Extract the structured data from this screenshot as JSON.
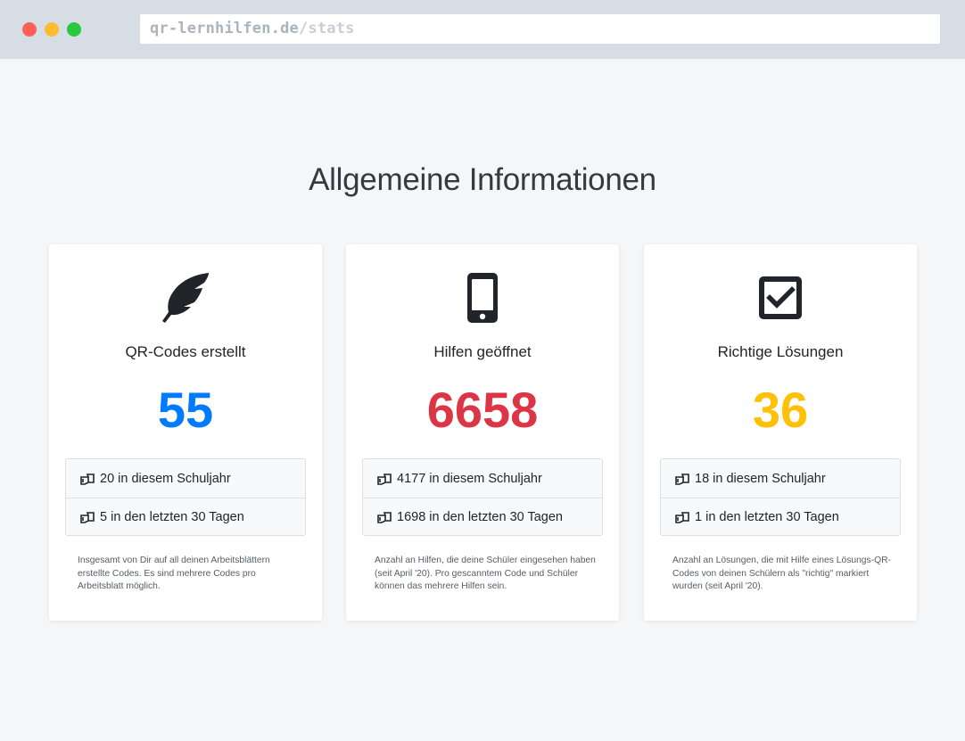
{
  "browser": {
    "url_domain": "qr-lernhilfen.de",
    "url_path": "/stats"
  },
  "page": {
    "title": "Allgemeine Informationen"
  },
  "cards": [
    {
      "icon": "feather-icon",
      "title": "QR-Codes erstellt",
      "value": "55",
      "color": "#007bff",
      "items": [
        "20 in diesem Schuljahr",
        "5 in den letzten 30 Tagen"
      ],
      "description": "Insgesamt von Dir auf all deinen Arbeitsblättern erstellte Codes. Es sind mehrere Codes pro Arbeitsblatt möglich."
    },
    {
      "icon": "mobile-phone-icon",
      "title": "Hilfen geöffnet",
      "value": "6658",
      "color": "#dc3545",
      "items": [
        "4177 in diesem Schuljahr",
        "1698 in den letzten 30 Tagen"
      ],
      "description": "Anzahl an Hilfen, die deine Schüler eingesehen haben (seit April '20). Pro gescanntem Code und Schüler können das mehrere Hilfen sein."
    },
    {
      "icon": "check-square-icon",
      "title": "Richtige Lösungen",
      "value": "36",
      "color": "#ffc107",
      "items": [
        "18 in diesem Schuljahr",
        "1 in den letzten 30 Tagen"
      ],
      "description": "Anzahl an Lösungen, die mit Hilfe eines Lösungs-QR-Codes von deinen Schülern als \"richtig\" markiert wurden (seit April '20)."
    }
  ]
}
